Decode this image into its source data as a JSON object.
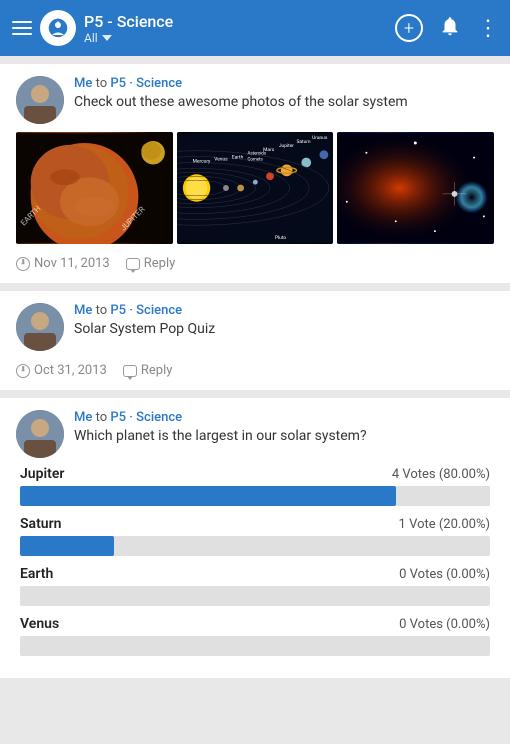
{
  "header": {
    "title": "P5 - Science",
    "subtitle": "All",
    "add_icon": "+",
    "bell_icon": "🔔",
    "more_icon": "⋮"
  },
  "posts": [
    {
      "id": "post1",
      "from_name": "Me",
      "to_channel": "P5 · Science",
      "text": "Check out these awesome photos of the solar system",
      "timestamp": "Nov 11, 2013",
      "has_images": true,
      "reply_label": "Reply"
    },
    {
      "id": "post2",
      "from_name": "Me",
      "to_channel": "P5 · Science",
      "text": "Solar System Pop Quiz",
      "timestamp": "Oct 31, 2013",
      "has_images": false,
      "reply_label": "Reply"
    },
    {
      "id": "post3",
      "from_name": "Me",
      "to_channel": "P5 · Science",
      "text": "Which planet is the largest in our solar system?",
      "has_poll": true,
      "poll_options": [
        {
          "label": "Jupiter",
          "votes": "4 Votes (80.00%)",
          "pct": 80
        },
        {
          "label": "Saturn",
          "votes": "1 Vote (20.00%)",
          "pct": 20
        },
        {
          "label": "Earth",
          "votes": "0 Votes (0.00%)",
          "pct": 0
        },
        {
          "label": "Venus",
          "votes": "0 Votes (0.00%)",
          "pct": 0
        }
      ]
    }
  ]
}
